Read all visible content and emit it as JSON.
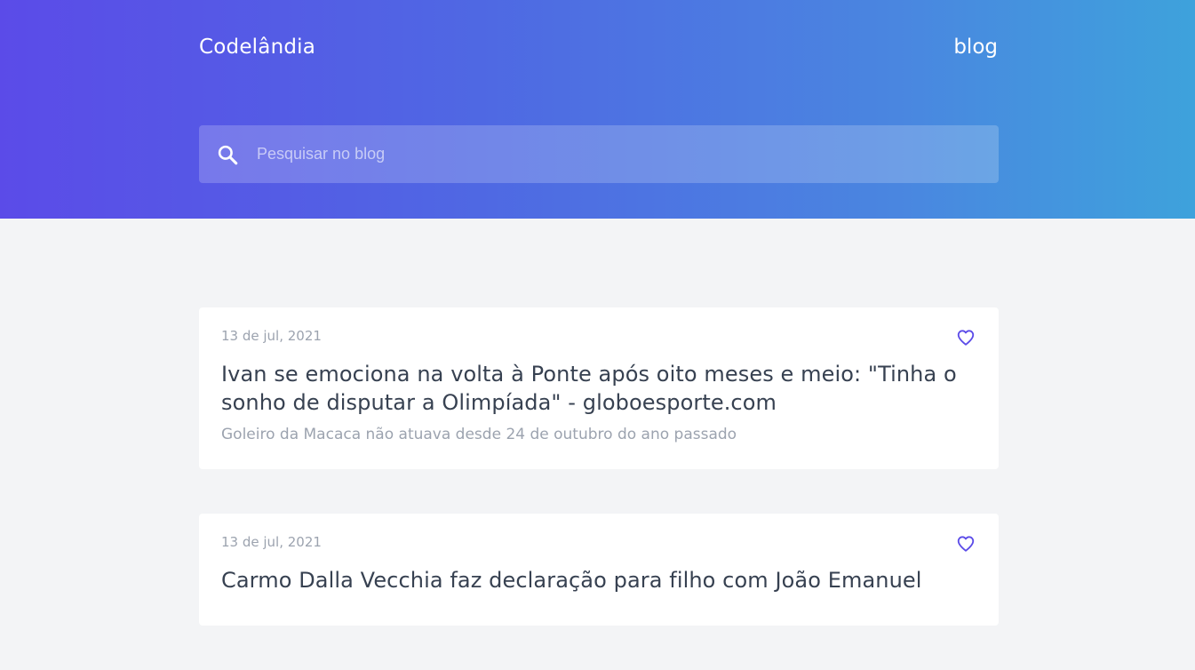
{
  "header": {
    "brand": "Codelândia",
    "nav_blog": "blog"
  },
  "search": {
    "placeholder": "Pesquisar no blog",
    "value": "",
    "icon": "search-icon"
  },
  "colors": {
    "gradient_start": "#5b4be8",
    "gradient_end": "#3ea2dc",
    "accent": "#5b4be8",
    "background": "#f3f4f6"
  },
  "posts": [
    {
      "date": "13 de jul, 2021",
      "title": "Ivan se emociona na volta à Ponte após oito meses e meio: \"Tinha o sonho de disputar a Olimpíada\" - globoesporte.com",
      "description": "Goleiro da Macaca não atuava desde 24 de outubro do ano passado",
      "icon": "heart-icon"
    },
    {
      "date": "13 de jul, 2021",
      "title": "Carmo Dalla Vecchia faz declaração para filho com João Emanuel",
      "description": "",
      "icon": "heart-icon"
    }
  ]
}
